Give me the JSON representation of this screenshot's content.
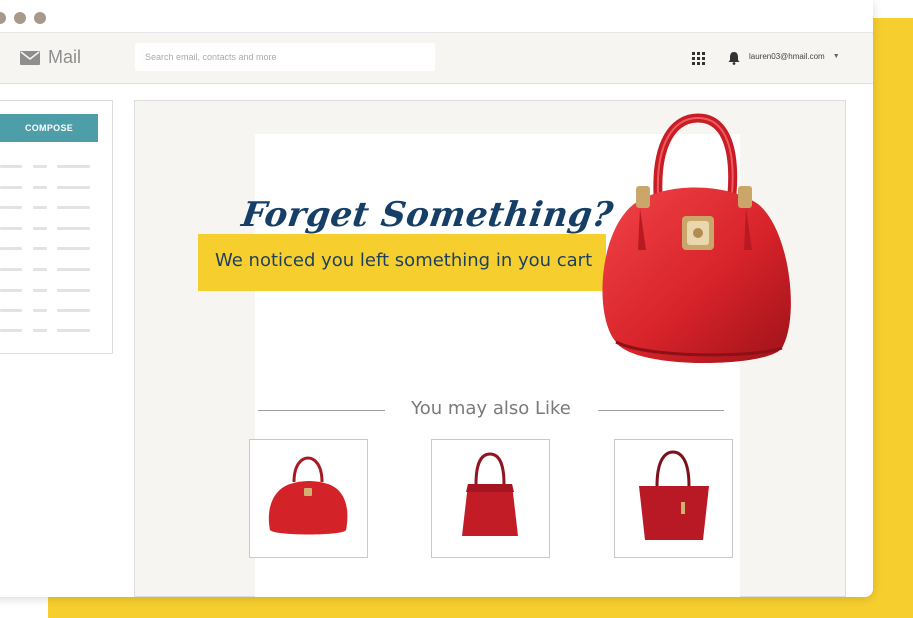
{
  "app": {
    "name": "Mail",
    "search_placeholder": "Search email, contacts and more",
    "account_email": "lauren03@hmail.com"
  },
  "sidebar": {
    "compose_label": "COMPOSE"
  },
  "email": {
    "headline": "Forget Something?",
    "subline": "We noticed you left something in you cart",
    "recommend_title": "You may also Like"
  },
  "colors": {
    "accent_yellow": "#f6cf2f",
    "compose_teal": "#4d9ea9",
    "headline_navy": "#153f66",
    "bag_red": "#d8232a"
  },
  "icons": {
    "mail": "envelope-icon",
    "apps": "grid-icon",
    "notifications": "bell-icon",
    "account_menu": "chevron-down-icon"
  }
}
